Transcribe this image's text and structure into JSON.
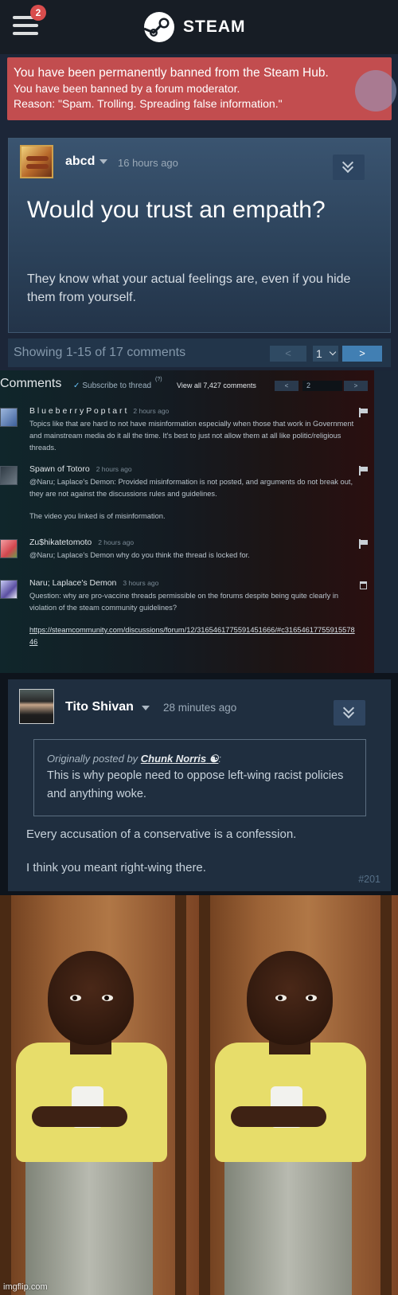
{
  "header": {
    "notification_count": "2",
    "brand": "STEAM"
  },
  "ban": {
    "line1": "You have been permanently banned from the Steam Hub.",
    "line2": "You have been banned by a forum moderator.",
    "line3": "Reason: \"Spam. Trolling. Spreading false information.\""
  },
  "post": {
    "author": "abcd",
    "time": "16 hours ago",
    "title": "Would you trust an empath?",
    "body": "They know what your actual feelings are, even if you hide them from yourself."
  },
  "pager": {
    "showing": "Showing 1-15 of 17 comments",
    "prev": "<",
    "page": "1",
    "next": ">"
  },
  "thread": {
    "heading": "Comments",
    "subscribe": "Subscribe to thread",
    "help": "(?)",
    "view_all": "View all 7,427 comments",
    "prev": "<",
    "page": "2",
    "next": ">",
    "comments": [
      {
        "author": "B l u e b e r r y P o p t a r t",
        "time": "2 hours ago",
        "text": "Topics like that are hard to not have misinformation especially when those that work in Government and mainstream media do it all the time. It's best to just not allow them at all like politic/religious threads."
      },
      {
        "author": "Spawn of Totoro",
        "time": "2 hours ago",
        "text": "@Naru; Laplace's Demon: Provided misinformation is not posted, and arguments do not break out, they are not against the discussions rules and guidelines.",
        "text2": "The video you linked is of misinformation."
      },
      {
        "author": "Zu$hikatetomoto",
        "time": "2 hours ago",
        "text": "@Naru; Laplace's Demon why do you think the thread is locked for."
      },
      {
        "author": "Naru; Laplace's Demon",
        "time": "3 hours ago",
        "text": "Question: why are pro-vaccine threads permissible on the forums despite being quite clearly in violation of the steam community guidelines?",
        "link": "https://steamcommunity.com/discussions/forum/12/3165461775591451666/#c3165461775591557846"
      }
    ]
  },
  "reply": {
    "author": "Tito Shivan",
    "time": "28 minutes ago",
    "quote_prefix": "Originally posted by",
    "quote_author": "Chunk Norris",
    "quote_author_icon": "☯",
    "quote_suffix": ":",
    "quote_text": "This is why people need to oppose left-wing racist policies and anything woke.",
    "body1": "Every accusation of a conservative is a confession.",
    "body2": "I think you meant right-wing there.",
    "number": "#201"
  },
  "watermark": "imgflip.com",
  "colors": {
    "ban_bg": "#c24d4f",
    "card_bg": "#2b4159",
    "accent_blue": "#417fb3",
    "badge_red": "#d94d4d"
  }
}
